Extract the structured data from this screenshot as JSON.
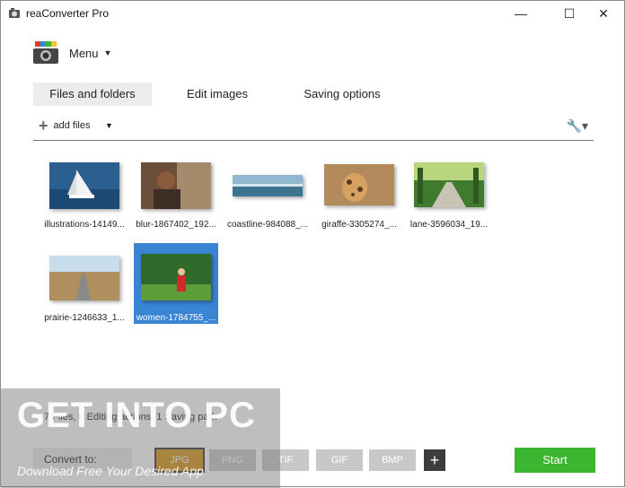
{
  "window": {
    "title": "reaConverter Pro"
  },
  "menu": {
    "label": "Menu"
  },
  "tabs": [
    {
      "label": "Files and folders",
      "active": true
    },
    {
      "label": "Edit images",
      "active": false
    },
    {
      "label": "Saving options",
      "active": false
    }
  ],
  "toolbar": {
    "add_files_label": "add files"
  },
  "files": [
    {
      "caption": "illustrations-14149...",
      "selected": false
    },
    {
      "caption": "blur-1867402_192...",
      "selected": false
    },
    {
      "caption": "coastline-984088_...",
      "selected": false
    },
    {
      "caption": "giraffe-3305274_...",
      "selected": false
    },
    {
      "caption": "lane-3596034_19...",
      "selected": false
    },
    {
      "caption": "prairie-1246633_1...",
      "selected": false
    },
    {
      "caption": "women-1784755_...",
      "selected": true
    }
  ],
  "status": {
    "text": "7 Files, 0 Editing actions, 1 Saving path"
  },
  "convert": {
    "label": "Convert to:",
    "formats": [
      "JPG",
      "PNG",
      "TIF",
      "GIF",
      "BMP"
    ],
    "selected_format": "JPG"
  },
  "start_label": "Start",
  "watermark": {
    "title": "GET INTO PC",
    "subtitle": "Download Free Your Desired App"
  },
  "colors": {
    "start": "#3cb531",
    "selected_format": "#d9951a",
    "selection": "#3a84d4"
  }
}
